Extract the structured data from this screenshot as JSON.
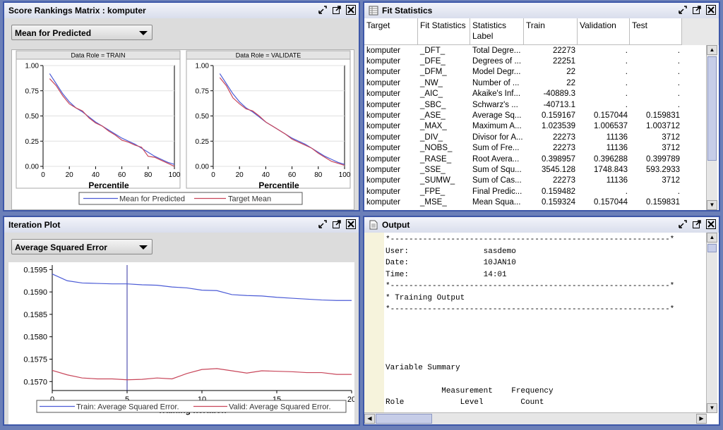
{
  "score_panel": {
    "title": "Score Rankings Matrix : komputer",
    "select_value": "Mean for Predicted",
    "train_title": "Data Role = TRAIN",
    "validate_title": "Data Role = VALIDATE",
    "xlabel": "Percentile",
    "legend": [
      "Mean for Predicted",
      "Target Mean"
    ]
  },
  "fit_panel": {
    "title": "Fit Statistics",
    "columns": [
      "Target",
      "Fit Statistics",
      "Statistics Label",
      "Train",
      "Validation",
      "Test"
    ],
    "rows": [
      [
        "komputer",
        "_DFT_",
        "Total Degre...",
        "22273",
        ".",
        "."
      ],
      [
        "komputer",
        "_DFE_",
        "Degrees of ...",
        "22251",
        ".",
        "."
      ],
      [
        "komputer",
        "_DFM_",
        "Model Degr...",
        "22",
        ".",
        "."
      ],
      [
        "komputer",
        "_NW_",
        "Number of ...",
        "22",
        ".",
        "."
      ],
      [
        "komputer",
        "_AIC_",
        "Akaike's Inf...",
        "-40889.3",
        ".",
        "."
      ],
      [
        "komputer",
        "_SBC_",
        "Schwarz's ...",
        "-40713.1",
        ".",
        "."
      ],
      [
        "komputer",
        "_ASE_",
        "Average Sq...",
        "0.159167",
        "0.157044",
        "0.159831"
      ],
      [
        "komputer",
        "_MAX_",
        "Maximum A...",
        "1.023539",
        "1.006537",
        "1.003712"
      ],
      [
        "komputer",
        "_DIV_",
        "Divisor for A...",
        "22273",
        "11136",
        "3712"
      ],
      [
        "komputer",
        "_NOBS_",
        "Sum of Fre...",
        "22273",
        "11136",
        "3712"
      ],
      [
        "komputer",
        "_RASE_",
        "Root Avera...",
        "0.398957",
        "0.396288",
        "0.399789"
      ],
      [
        "komputer",
        "_SSE_",
        "Sum of Squ...",
        "3545.128",
        "1748.843",
        "593.2933"
      ],
      [
        "komputer",
        "_SUMW_",
        "Sum of Cas...",
        "22273",
        "11136",
        "3712"
      ],
      [
        "komputer",
        "_FPE_",
        "Final Predic...",
        "0.159482",
        ".",
        "."
      ],
      [
        "komputer",
        "_MSE_",
        "Mean Squa...",
        "0.159324",
        "0.157044",
        "0.159831"
      ]
    ]
  },
  "iter_panel": {
    "title": "Iteration Plot",
    "select_value": "Average Squared Error",
    "xlabel": "Training Iteration",
    "legend": [
      "Train: Average Squared Error.",
      "Valid: Average Squared Error."
    ]
  },
  "output_panel": {
    "title": "Output",
    "lines": [
      "*------------------------------------------------------------*",
      "User:                sasdemo",
      "Date:                10JAN10",
      "Time:                14:01",
      "*------------------------------------------------------------*",
      "* Training Output",
      "*------------------------------------------------------------*",
      "",
      "",
      "",
      "",
      "Variable Summary",
      "",
      "            Measurement    Frequency",
      "Role            Level        Count"
    ]
  },
  "colors": {
    "train": "#4b5bd6",
    "valid": "#c8465a",
    "accent": "#3d57a8"
  },
  "chart_data": [
    {
      "type": "line",
      "title": "Data Role = TRAIN",
      "xlabel": "Percentile",
      "ylabel": "",
      "xlim": [
        0,
        100
      ],
      "ylim": [
        0,
        1
      ],
      "xticks": [
        0,
        20,
        40,
        60,
        80,
        100
      ],
      "yticks": [
        "0.00",
        "0.25",
        "0.50",
        "0.75",
        "1.00"
      ],
      "series": [
        {
          "name": "Mean for Predicted",
          "x": [
            5,
            10,
            15,
            20,
            25,
            30,
            35,
            40,
            45,
            50,
            55,
            60,
            65,
            70,
            75,
            80,
            85,
            90,
            95,
            100
          ],
          "y": [
            0.92,
            0.82,
            0.72,
            0.64,
            0.58,
            0.54,
            0.49,
            0.44,
            0.4,
            0.36,
            0.32,
            0.28,
            0.25,
            0.22,
            0.18,
            0.14,
            0.1,
            0.07,
            0.04,
            0.02
          ]
        },
        {
          "name": "Target Mean",
          "x": [
            5,
            10,
            15,
            20,
            25,
            30,
            35,
            40,
            45,
            50,
            55,
            60,
            65,
            70,
            75,
            80,
            85,
            90,
            95,
            100
          ],
          "y": [
            0.87,
            0.8,
            0.7,
            0.62,
            0.58,
            0.55,
            0.48,
            0.43,
            0.4,
            0.35,
            0.31,
            0.26,
            0.24,
            0.21,
            0.19,
            0.1,
            0.09,
            0.06,
            0.03,
            0.0
          ]
        }
      ]
    },
    {
      "type": "line",
      "title": "Data Role = VALIDATE",
      "xlabel": "Percentile",
      "ylabel": "",
      "xlim": [
        0,
        100
      ],
      "ylim": [
        0,
        1
      ],
      "xticks": [
        0,
        20,
        40,
        60,
        80,
        100
      ],
      "yticks": [
        "0.00",
        "0.25",
        "0.50",
        "0.75",
        "1.00"
      ],
      "series": [
        {
          "name": "Mean for Predicted",
          "x": [
            5,
            10,
            15,
            20,
            25,
            30,
            35,
            40,
            45,
            50,
            55,
            60,
            65,
            70,
            75,
            80,
            85,
            90,
            95,
            100
          ],
          "y": [
            0.92,
            0.82,
            0.72,
            0.64,
            0.58,
            0.54,
            0.49,
            0.44,
            0.4,
            0.36,
            0.32,
            0.28,
            0.25,
            0.22,
            0.18,
            0.14,
            0.1,
            0.07,
            0.04,
            0.02
          ]
        },
        {
          "name": "Target Mean",
          "x": [
            5,
            10,
            15,
            20,
            25,
            30,
            35,
            40,
            45,
            50,
            55,
            60,
            65,
            70,
            75,
            80,
            85,
            90,
            95,
            100
          ],
          "y": [
            0.88,
            0.8,
            0.68,
            0.62,
            0.57,
            0.55,
            0.5,
            0.44,
            0.4,
            0.36,
            0.32,
            0.27,
            0.24,
            0.21,
            0.18,
            0.13,
            0.09,
            0.05,
            0.03,
            0.01
          ]
        }
      ]
    },
    {
      "type": "line",
      "title": "",
      "xlabel": "Training Iteration",
      "ylabel": "",
      "xlim": [
        0,
        20
      ],
      "ylim": [
        0.1568,
        0.1596
      ],
      "xticks": [
        0,
        5,
        10,
        15,
        20
      ],
      "yticks": [
        "0.1570",
        "0.1575",
        "0.1580",
        "0.1585",
        "0.1590",
        "0.1595"
      ],
      "vline": 5,
      "series": [
        {
          "name": "Train: Average Squared Error.",
          "x": [
            0,
            1,
            2,
            3,
            4,
            5,
            6,
            7,
            8,
            9,
            10,
            11,
            12,
            13,
            14,
            15,
            16,
            17,
            18,
            19,
            20
          ],
          "y": [
            0.1594,
            0.15925,
            0.1592,
            0.15919,
            0.15918,
            0.15918,
            0.15916,
            0.15915,
            0.15911,
            0.15909,
            0.15904,
            0.15903,
            0.15894,
            0.15892,
            0.15891,
            0.15888,
            0.15886,
            0.15884,
            0.15882,
            0.15881,
            0.15881
          ]
        },
        {
          "name": "Valid: Average Squared Error.",
          "x": [
            0,
            1,
            2,
            3,
            4,
            5,
            6,
            7,
            8,
            9,
            10,
            11,
            12,
            13,
            14,
            15,
            16,
            17,
            18,
            19,
            20
          ],
          "y": [
            0.15725,
            0.15715,
            0.15708,
            0.15706,
            0.15706,
            0.15704,
            0.15705,
            0.15708,
            0.15706,
            0.15718,
            0.15727,
            0.15729,
            0.15724,
            0.15719,
            0.15724,
            0.15723,
            0.15722,
            0.1572,
            0.1572,
            0.15716,
            0.15716
          ]
        }
      ]
    }
  ]
}
